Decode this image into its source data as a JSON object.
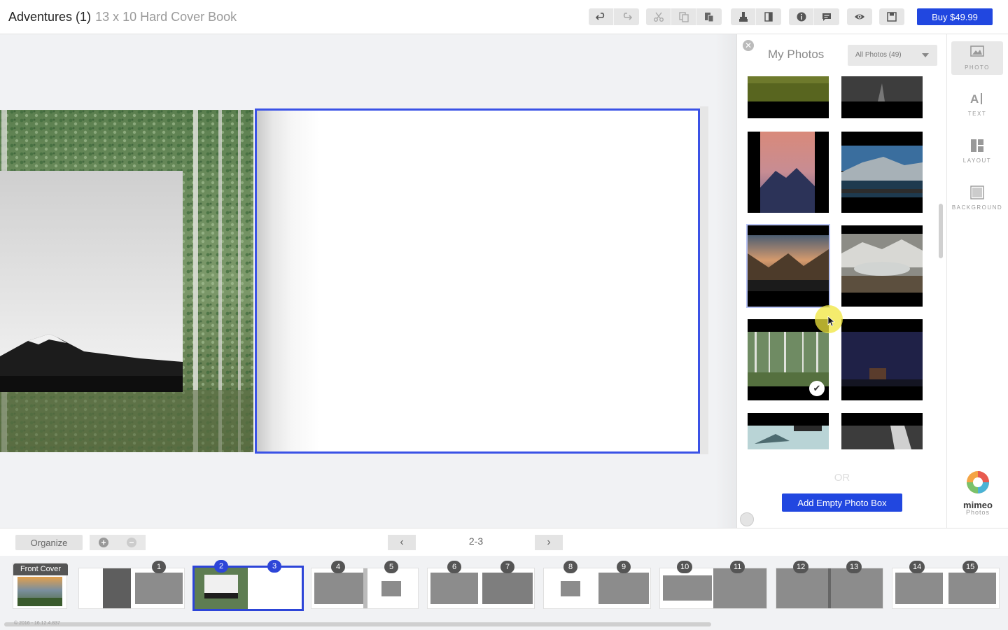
{
  "header": {
    "project_title": "Adventures (1)",
    "product": "13 x 10 Hard Cover Book",
    "buy_label": "Buy $49.99"
  },
  "toolbar_icons": [
    "undo-icon",
    "redo-icon",
    "cut-icon",
    "copy-icon",
    "paste-icon",
    "apply-layout-icon",
    "mirror-icon",
    "info-icon",
    "comment-icon",
    "preview-icon",
    "save-icon"
  ],
  "panel": {
    "heading": "My Photos",
    "filter_selected": "All Photos (49)",
    "or_label": "OR",
    "add_empty_label": "Add Empty Photo Box"
  },
  "sidebar": {
    "items": [
      {
        "label": "PHOTO",
        "icon": "photo-icon",
        "active": true
      },
      {
        "label": "TEXT",
        "icon": "text-icon",
        "active": false
      },
      {
        "label": "LAYOUT",
        "icon": "layout-icon",
        "active": false
      },
      {
        "label": "BACKGROUND",
        "icon": "background-icon",
        "active": false
      }
    ],
    "brand": "mimeo",
    "brand_sub": "Photos"
  },
  "bottombar": {
    "organize_label": "Organize",
    "page_indicator": "2-3"
  },
  "strip": {
    "front_cover_label": "Front Cover",
    "page_numbers": [
      "1",
      "2",
      "3",
      "4",
      "5",
      "6",
      "7",
      "8",
      "9",
      "10",
      "11",
      "12",
      "13",
      "14",
      "15"
    ]
  },
  "footer": {
    "copyright": "© 2016 - 16.12.4.837"
  },
  "colors": {
    "accent": "#2147e0",
    "selection": "#3a52e6"
  }
}
